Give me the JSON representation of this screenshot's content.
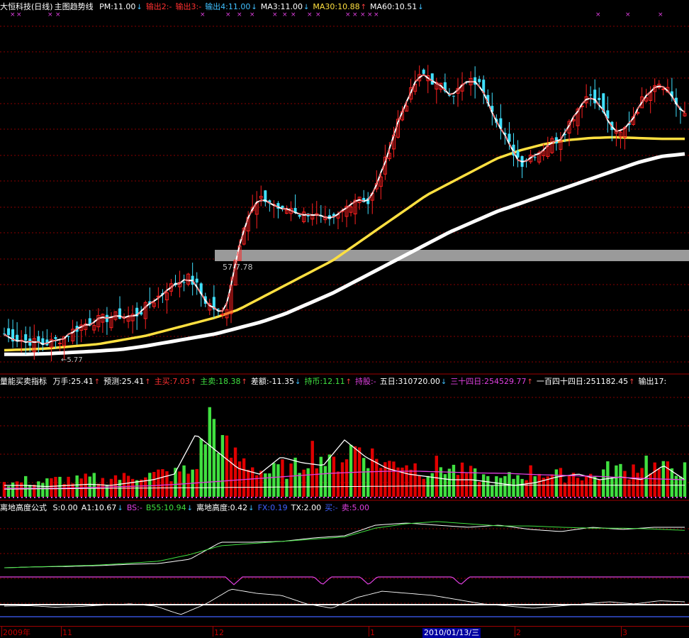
{
  "colors": {
    "up": "#ff2020",
    "down": "#40e0ff",
    "ma30": "#ffe040",
    "ma60": "#ffffff",
    "grid": "#8a0000",
    "vol_up": "#e00000",
    "vol_down": "#40e040",
    "purple": "#e040e0",
    "green": "#40e040",
    "blue": "#4060ff"
  },
  "main_panel": {
    "title": "大恒科技(日线)",
    "indicator": "主图趋势线",
    "items": [
      {
        "label": "PM:11.00",
        "color": "#ffffff",
        "arrow": "↓"
      },
      {
        "label": "输出2:-",
        "color": "#ff3030",
        "arrow": ""
      },
      {
        "label": "输出3:-",
        "color": "#ff3030",
        "arrow": ""
      },
      {
        "label": "输出4:11.00",
        "color": "#40c0ff",
        "arrow": "↓"
      },
      {
        "label": "MA3:11.00",
        "color": "#ffffff",
        "arrow": "↓"
      },
      {
        "label": "MA30:10.88",
        "color": "#ffe040",
        "arrow": "↑"
      },
      {
        "label": "MA60:10.51",
        "color": "#ffffff",
        "arrow": "↓"
      }
    ],
    "band_label": "57-7.78",
    "low_label": "←5.77"
  },
  "volume_panel": {
    "title": "量能买卖指标",
    "items": [
      {
        "label": "万手:25.41",
        "color": "#ffffff",
        "arrow": "↑"
      },
      {
        "label": "预测:25.41",
        "color": "#ffffff",
        "arrow": "↑"
      },
      {
        "label": "主买:7.03",
        "color": "#ff3030",
        "arrow": "↑"
      },
      {
        "label": "主卖:18.38",
        "color": "#40e040",
        "arrow": "↑"
      },
      {
        "label": "差额:-11.35",
        "color": "#ffffff",
        "arrow": "↓"
      },
      {
        "label": "持币:12.11",
        "color": "#40e040",
        "arrow": "↑"
      },
      {
        "label": "持股:-",
        "color": "#e040e0",
        "arrow": ""
      },
      {
        "label": "五日:310720.00",
        "color": "#ffffff",
        "arrow": "↓"
      },
      {
        "label": "三十四日:254529.77",
        "color": "#e040e0",
        "arrow": "↑"
      },
      {
        "label": "一百四十四日:251182.45",
        "color": "#ffffff",
        "arrow": "↑"
      },
      {
        "label": "输出17:",
        "color": "#ffffff",
        "arrow": ""
      }
    ]
  },
  "height_panel": {
    "title": "离地高度公式",
    "items": [
      {
        "label": "S:0.00",
        "color": "#ffffff",
        "arrow": ""
      },
      {
        "label": "A1:10.67",
        "color": "#ffffff",
        "arrow": "↓"
      },
      {
        "label": "BS:-",
        "color": "#e040e0",
        "arrow": ""
      },
      {
        "label": "B55:10.94",
        "color": "#40e040",
        "arrow": "↓"
      },
      {
        "label": "离地高度:0.42",
        "color": "#ffffff",
        "arrow": "↓"
      },
      {
        "label": "FX:0.19",
        "color": "#4060ff",
        "arrow": ""
      },
      {
        "label": "TX:2.00",
        "color": "#ffffff",
        "arrow": ""
      },
      {
        "label": "买:-",
        "color": "#4060ff",
        "arrow": ""
      },
      {
        "label": "卖:5.00",
        "color": "#e040e0",
        "arrow": ""
      }
    ]
  },
  "date_axis": {
    "labels": [
      "2009年",
      "11",
      "12",
      "1",
      "2010/01/13/三",
      "2",
      "3"
    ]
  },
  "chart_data": {
    "type": "candlestick",
    "title": "大恒科技(日线)",
    "candles_sampled_close": [
      6.1,
      6.0,
      5.95,
      5.9,
      5.85,
      5.9,
      6.0,
      6.15,
      6.3,
      6.4,
      6.45,
      6.5,
      6.55,
      6.5,
      6.6,
      6.8,
      7.0,
      7.2,
      7.35,
      7.5,
      7.3,
      6.9,
      6.7,
      6.5,
      7.8,
      8.8,
      9.2,
      9.4,
      9.3,
      9.1,
      9.2,
      9.0,
      9.1,
      8.9,
      8.8,
      9.0,
      9.3,
      9.5,
      9.3,
      9.8,
      10.5,
      11.3,
      11.8,
      12.3,
      12.5,
      12.2,
      12.1,
      12.0,
      12.2,
      12.3,
      12.1,
      11.6,
      11.0,
      10.6,
      10.3,
      10.5,
      10.6,
      10.8,
      10.9,
      11.3,
      11.7,
      12.0,
      11.8,
      11.3,
      10.9,
      11.2,
      11.6,
      12.0,
      12.3,
      12.2,
      11.8,
      11.4
    ],
    "ma30_sampled": [
      5.7,
      5.72,
      5.75,
      5.8,
      5.85,
      5.95,
      6.05,
      6.2,
      6.35,
      6.5,
      6.7,
      7.0,
      7.3,
      7.6,
      7.9,
      8.3,
      8.7,
      9.1,
      9.5,
      9.8,
      10.1,
      10.4,
      10.6,
      10.75,
      10.85,
      10.9,
      10.92,
      10.9,
      10.88,
      10.88
    ],
    "ma60_sampled": [
      5.6,
      5.6,
      5.62,
      5.65,
      5.68,
      5.72,
      5.8,
      5.9,
      6.0,
      6.1,
      6.25,
      6.4,
      6.6,
      6.85,
      7.1,
      7.4,
      7.7,
      8.0,
      8.3,
      8.6,
      8.85,
      9.1,
      9.3,
      9.5,
      9.7,
      9.9,
      10.1,
      10.3,
      10.45,
      10.51
    ],
    "band_range": [
      7.57,
      7.78
    ],
    "low_price": 5.77
  }
}
